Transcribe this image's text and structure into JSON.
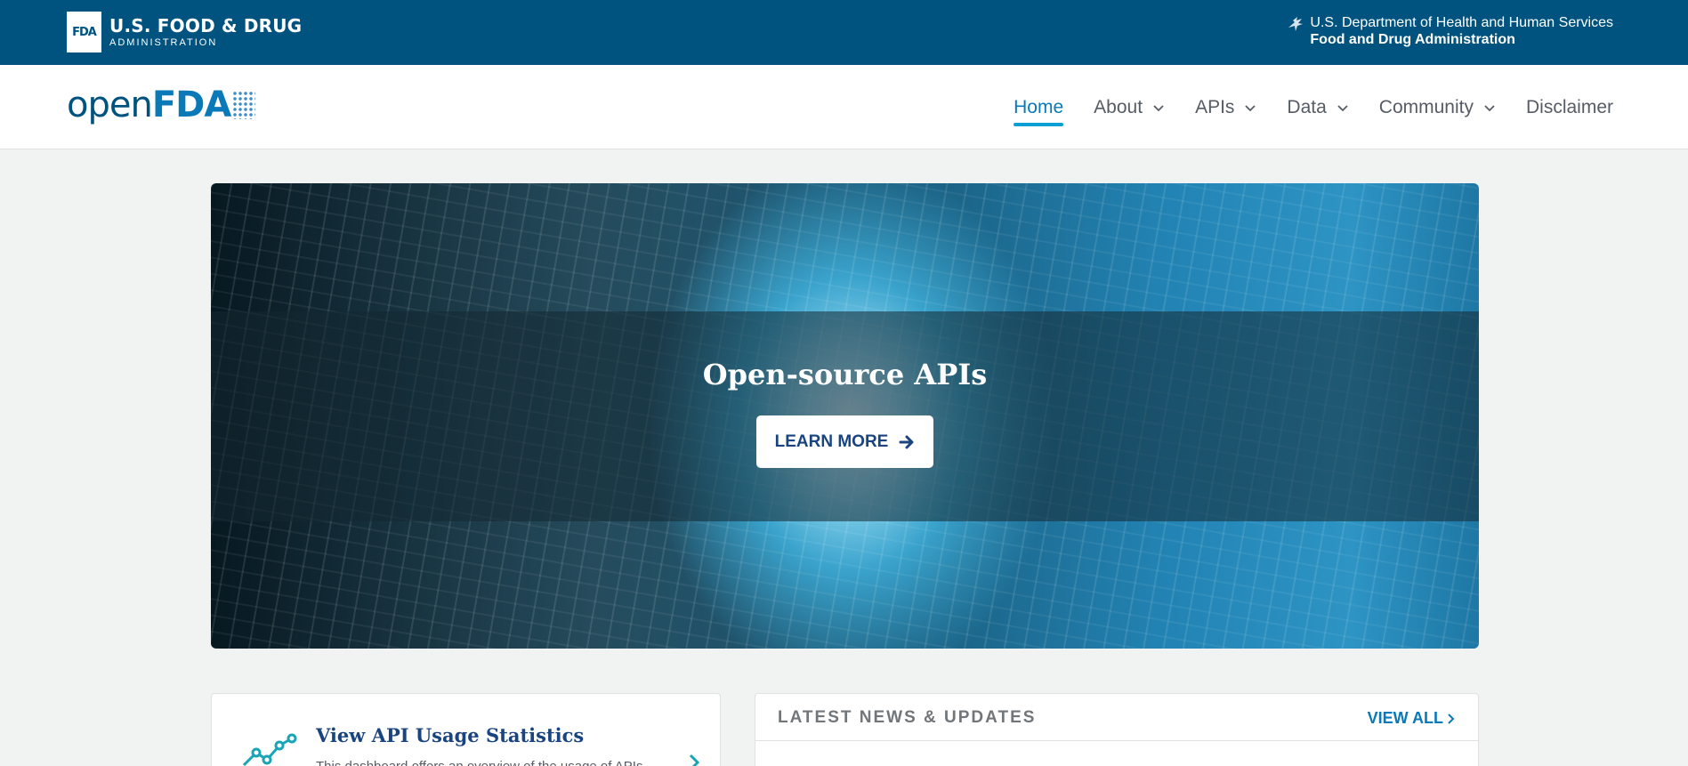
{
  "topbar": {
    "fda_abbrev": "FDA",
    "agency_name": "U.S. FOOD & DRUG",
    "agency_sub": "ADMINISTRATION",
    "hhs_line1": "U.S. Department of Health and Human Services",
    "hhs_line2": "Food and Drug Administration",
    "bg_color": "#00537f"
  },
  "navbar": {
    "brand_open": "open",
    "brand_fda": "FDA",
    "items": [
      {
        "label": "Home",
        "active": true,
        "dropdown": false
      },
      {
        "label": "About",
        "active": false,
        "dropdown": true
      },
      {
        "label": "APIs",
        "active": false,
        "dropdown": true
      },
      {
        "label": "Data",
        "active": false,
        "dropdown": true
      },
      {
        "label": "Community",
        "active": false,
        "dropdown": true
      },
      {
        "label": "Disclaimer",
        "active": false,
        "dropdown": false
      }
    ],
    "accent_color": "#0a79b8"
  },
  "hero": {
    "title": "Open-source APIs",
    "button_label": "LEARN MORE",
    "button_icon": "arrow-right-icon"
  },
  "stats_card": {
    "title": "View API Usage Statistics",
    "description": "This dashboard offers an overview of the usage of APIs",
    "icon": "line-chart-icon"
  },
  "news": {
    "title": "LATEST NEWS & UPDATES",
    "view_all": "VIEW ALL"
  }
}
